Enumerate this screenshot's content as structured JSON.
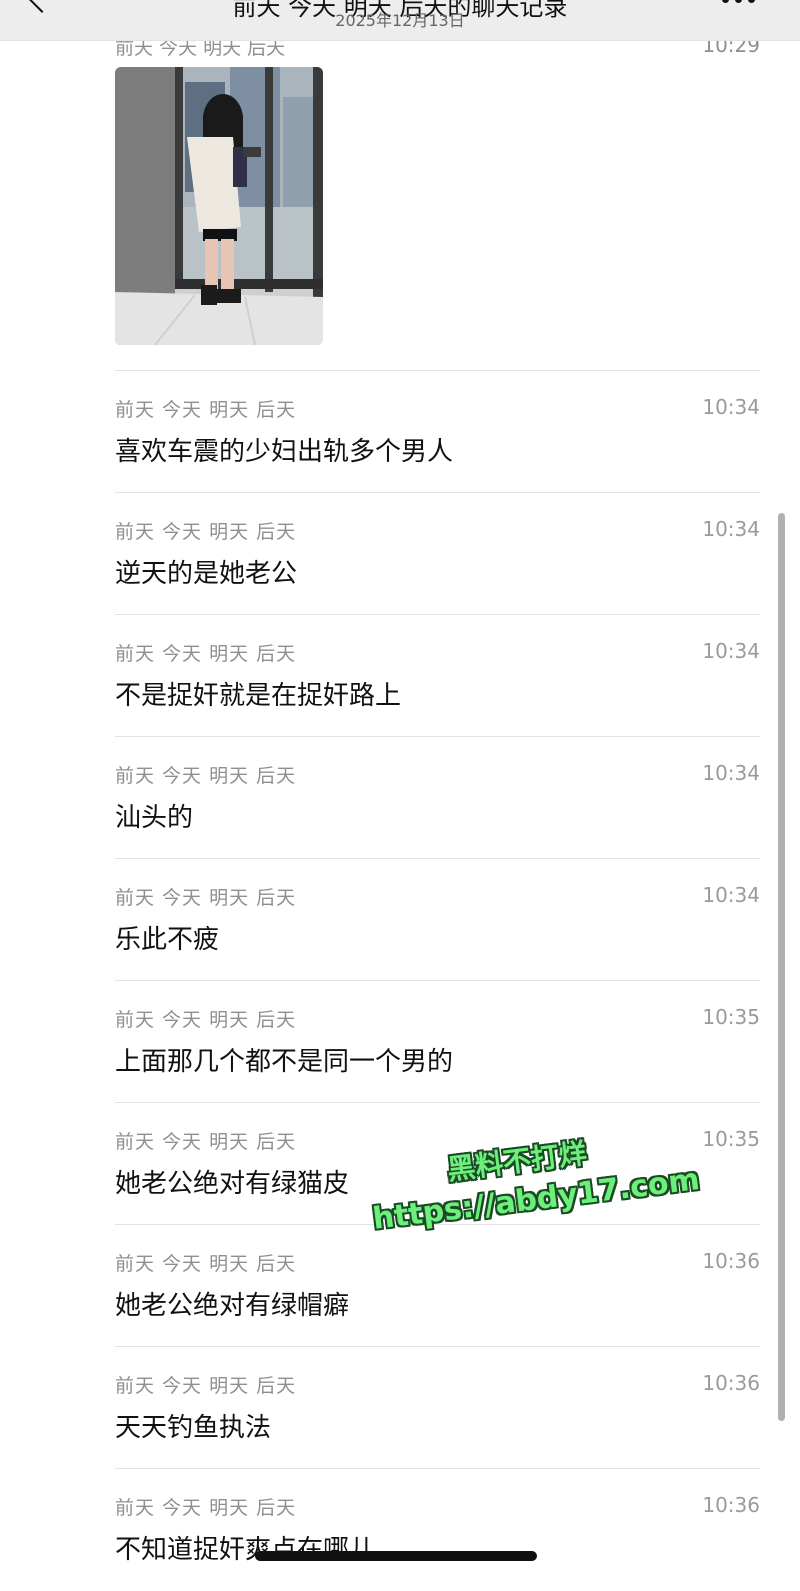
{
  "header": {
    "title": "前天 今天 明天 后天的聊天记录",
    "date": "2025年12月13日",
    "back_icon": "chevron-left-icon",
    "more_icon": "more-dots-icon"
  },
  "first_entry": {
    "sender": "前天 今天 明天 后天",
    "time": "10:29",
    "image": "woman-standing-by-window-photo"
  },
  "messages": [
    {
      "sender": "前天 今天 明天 后天",
      "time": "10:34",
      "text": "喜欢车震的少妇出轨多个男人"
    },
    {
      "sender": "前天 今天 明天 后天",
      "time": "10:34",
      "text": "逆天的是她老公"
    },
    {
      "sender": "前天 今天 明天 后天",
      "time": "10:34",
      "text": "不是捉奸就是在捉奸路上"
    },
    {
      "sender": "前天 今天 明天 后天",
      "time": "10:34",
      "text": "汕头的"
    },
    {
      "sender": "前天 今天 明天 后天",
      "time": "10:34",
      "text": "乐此不疲"
    },
    {
      "sender": "前天 今天 明天 后天",
      "time": "10:35",
      "text": "上面那几个都不是同一个男的"
    },
    {
      "sender": "前天 今天 明天 后天",
      "time": "10:35",
      "text": "她老公绝对有绿猫皮"
    },
    {
      "sender": "前天 今天 明天 后天",
      "time": "10:36",
      "text": "她老公绝对有绿帽癖"
    },
    {
      "sender": "前天 今天 明天 后天",
      "time": "10:36",
      "text": "天天钓鱼执法"
    },
    {
      "sender": "前天 今天 明天 后天",
      "time": "10:36",
      "text": "不知道捉奸爽点在哪儿"
    }
  ],
  "watermark": {
    "line1": "黑料不打烊",
    "line2": "https://abdy17.com",
    "color": "#6cf07c"
  }
}
